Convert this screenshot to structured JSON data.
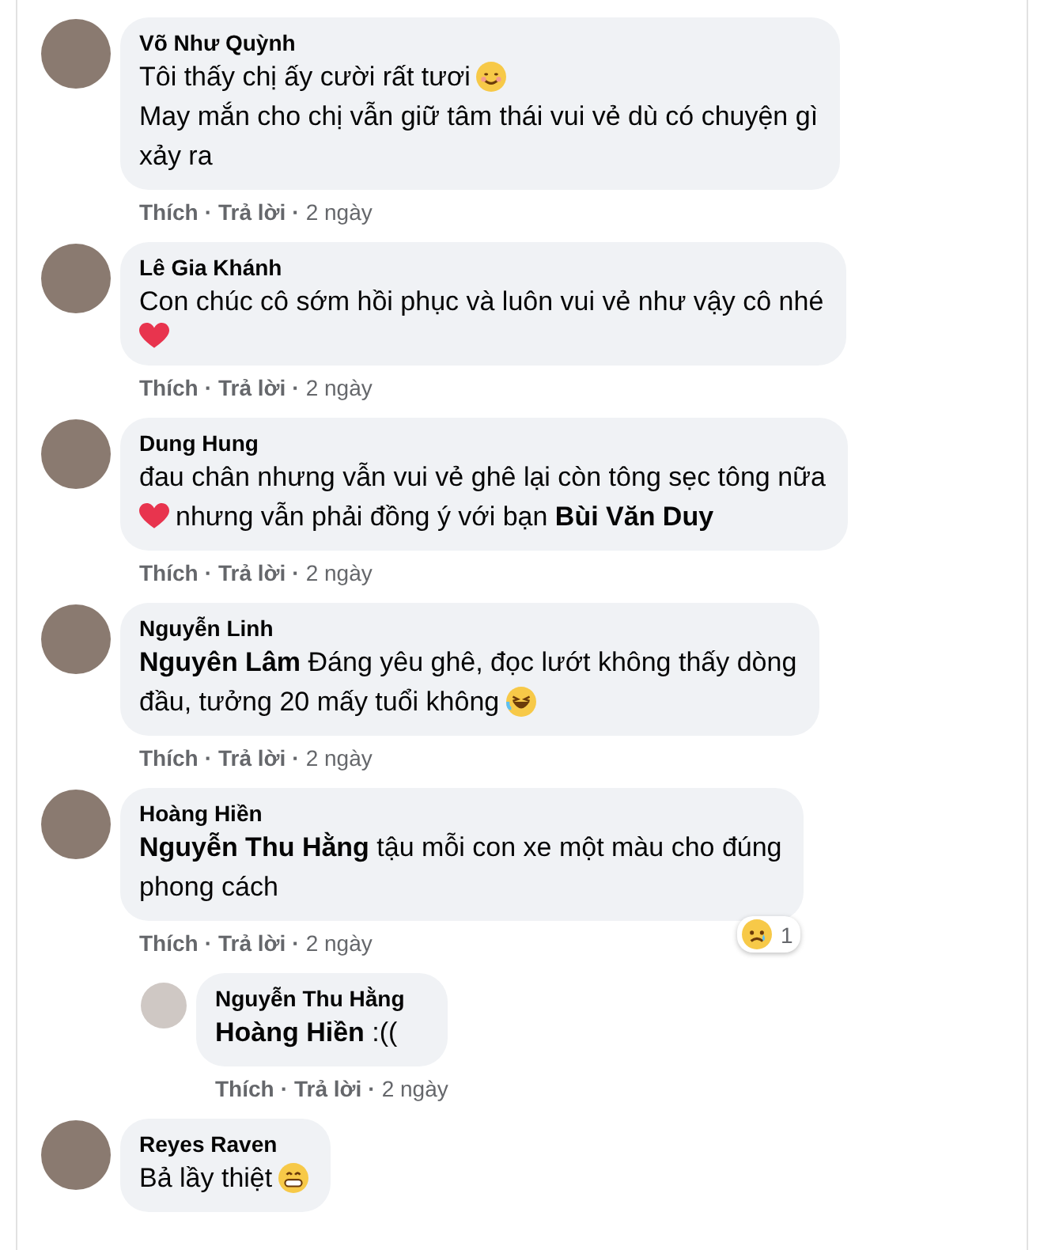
{
  "comments": [
    {
      "author": "Võ Như Quỳnh",
      "paragraphs": [
        [
          {
            "kind": "text",
            "text": "Tôi thấy chị ấy cười rất tươi"
          },
          {
            "kind": "smile"
          }
        ],
        [
          {
            "kind": "text",
            "text": "May mắn cho chị vẫn giữ tâm thái vui vẻ dù có chuyện gì"
          }
        ],
        [
          {
            "kind": "text",
            "text": "xảy ra"
          }
        ]
      ],
      "actions": [
        {
          "kind": "link",
          "text": "Thích"
        },
        {
          "kind": "separator",
          "text": "·"
        },
        {
          "kind": "link",
          "text": "Trả lời"
        },
        {
          "kind": "separator",
          "text": "·"
        },
        {
          "kind": "time",
          "text": "2 ngày"
        }
      ]
    },
    {
      "author": "Lê Gia Khánh",
      "paragraphs": [
        [
          {
            "kind": "text",
            "text": "Con chúc cô sớm hồi phục và luôn vui vẻ như vậy cô nhé"
          }
        ],
        [
          {
            "kind": "heart"
          }
        ]
      ],
      "actions": [
        {
          "kind": "link",
          "text": "Thích"
        },
        {
          "kind": "separator",
          "text": "·"
        },
        {
          "kind": "link",
          "text": "Trả lời"
        },
        {
          "kind": "separator",
          "text": "·"
        },
        {
          "kind": "time",
          "text": "2 ngày"
        }
      ]
    },
    {
      "author": "Dung Hung",
      "paragraphs": [
        [
          {
            "kind": "text",
            "text": "đau chân nhưng vẫn vui vẻ ghê lại còn tông sẹc tông nữa"
          }
        ],
        [
          {
            "kind": "heart"
          },
          {
            "kind": "text",
            "text": "nhưng vẫn phải đồng ý với bạn **Bùi Văn Duy**"
          }
        ]
      ],
      "actions": [
        {
          "kind": "link",
          "text": "Thích"
        },
        {
          "kind": "separator",
          "text": "·"
        },
        {
          "kind": "link",
          "text": "Trả lời"
        },
        {
          "kind": "separator",
          "text": "·"
        },
        {
          "kind": "time",
          "text": "2 ngày"
        }
      ]
    },
    {
      "author": "Nguyễn Linh",
      "paragraphs": [
        [
          {
            "kind": "text",
            "text": "**Nguyên Lâm** Đáng yêu ghê, đọc lướt không thấy dòng"
          }
        ],
        [
          {
            "kind": "text",
            "text": "đầu, tưởng 20 mấy tuổi không"
          },
          {
            "kind": "laugh"
          }
        ]
      ],
      "actions": [
        {
          "kind": "link",
          "text": "Thích"
        },
        {
          "kind": "separator",
          "text": "·"
        },
        {
          "kind": "link",
          "text": "Trả lời"
        },
        {
          "kind": "separator",
          "text": "·"
        },
        {
          "kind": "time",
          "text": "2 ngày"
        }
      ]
    },
    {
      "author": "Hoàng Hiền",
      "paragraphs": [
        [
          {
            "kind": "text",
            "text": "**Nguyễn Thu Hằng** tậu mỗi con xe một màu cho đúng"
          }
        ],
        [
          {
            "kind": "text",
            "text": "phong cách"
          }
        ]
      ],
      "reaction": {
        "kind": "sad",
        "count": "1"
      },
      "actions": [
        {
          "kind": "link",
          "text": "Thích"
        },
        {
          "kind": "separator",
          "text": "·"
        },
        {
          "kind": "link",
          "text": "Trả lời"
        },
        {
          "kind": "separator",
          "text": "·"
        },
        {
          "kind": "time",
          "text": "2 ngày"
        }
      ],
      "replies": [
        {
          "author": "Nguyễn Thu Hằng",
          "paragraphs": [
            [
              {
                "kind": "text",
                "text": "**Hoàng Hiền** :(("
              }
            ]
          ],
          "actions": [
            {
              "kind": "link",
              "text": "Thích"
            },
            {
              "kind": "separator",
              "text": "·"
            },
            {
              "kind": "link",
              "text": "Trả lời"
            },
            {
              "kind": "separator",
              "text": "·"
            },
            {
              "kind": "time",
              "text": "2 ngày"
            }
          ]
        }
      ]
    },
    {
      "author": "Reyes Raven",
      "paragraphs": [
        [
          {
            "kind": "text",
            "text": "Bả lầy thiệt"
          },
          {
            "kind": "grin"
          }
        ]
      ]
    }
  ]
}
